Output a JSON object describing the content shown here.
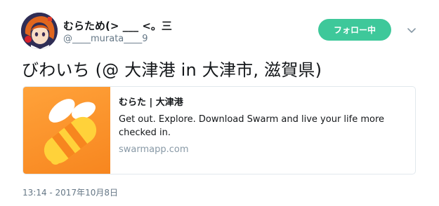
{
  "user": {
    "display_name": "むらため(> ___ <。三",
    "handle": "@____murata____9",
    "avatar_icon": "avatar-anime-character"
  },
  "follow_button": {
    "label": "フォロー中",
    "color": "#3ec89a"
  },
  "menu_icon": "chevron-down-icon",
  "tweet": {
    "text": "びわいち (@ 大津港 in 大津市, 滋賀県)",
    "timestamp": "13:14 - 2017年10月8日"
  },
  "card": {
    "image_icon": "swarm-bee-logo",
    "image_color": "#f7861f",
    "title": "むらた | 大津港",
    "description": "Get out. Explore. Download Swarm and live your life more checked in.",
    "domain": "swarmapp.com"
  }
}
